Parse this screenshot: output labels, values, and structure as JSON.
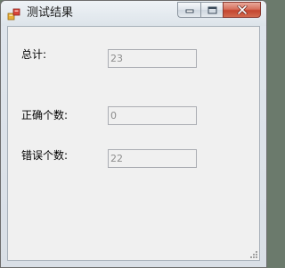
{
  "window": {
    "title": "测试结果",
    "icons": {
      "app": "app-icon",
      "minimize": "minimize-icon",
      "maximize": "maximize-icon",
      "close": "close-icon"
    }
  },
  "fields": {
    "total": {
      "label": "总计:",
      "value": "23"
    },
    "correct": {
      "label": "正确个数:",
      "value": "0"
    },
    "wrong": {
      "label": "错误个数:",
      "value": "22"
    }
  },
  "colors": {
    "close_button": "#c4452f",
    "client_background": "#f0f0f0",
    "disabled_text": "#8d8d8d"
  }
}
